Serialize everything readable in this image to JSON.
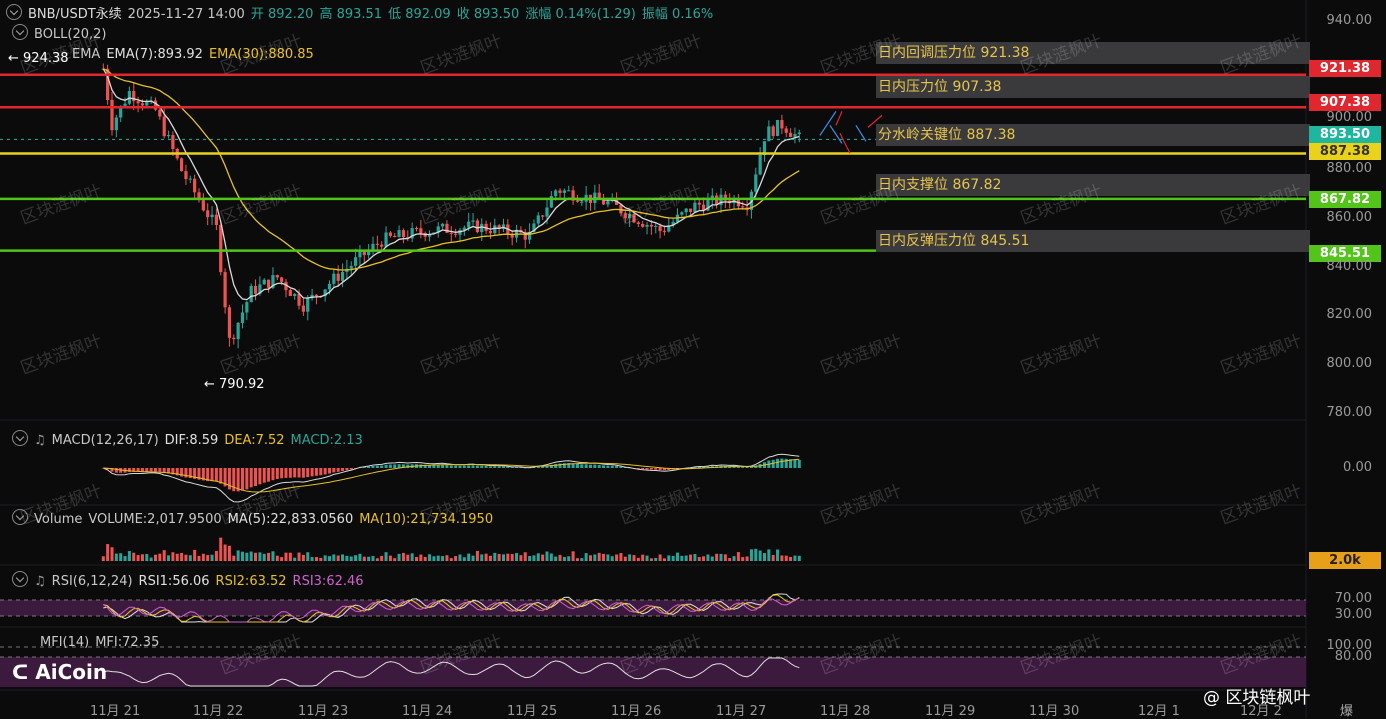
{
  "header": {
    "symbol": "BNB/USDT永续",
    "datetime": "2025-11-27 14:00",
    "open": "开 892.20",
    "high": "高 893.51",
    "low": "低 892.09",
    "close": "收 893.50",
    "change": "涨幅 0.14%(1.29)",
    "amplitude": "振幅 0.16%"
  },
  "indicators": {
    "boll": "BOLL(20,2)",
    "ema": "EMA",
    "ema7": "EMA(7):893.92",
    "ema30": "EMA(30):880.85",
    "macd_name": "MACD(12,26,17)",
    "dif": "DIF:8.59",
    "dea": "DEA:7.52",
    "macd": "MACD:2.13",
    "volume_name": "Volume",
    "volume": "VOLUME:2,017.9500",
    "ma5": "MA(5):22,833.0560",
    "ma10": "MA(10):21,734.1950",
    "rsi_name": "RSI(6,12,24)",
    "rsi1": "RSI1:56.06",
    "rsi2": "RSI2:63.52",
    "rsi3": "RSI3:62.46",
    "mfi_name": "MFI(14)",
    "mfi": "MFI:72.35"
  },
  "annotations": {
    "high_label": "← 924.38",
    "low_label": "← 790.92"
  },
  "levels": [
    {
      "label": "日内回调压力位 921.38",
      "price": "921.38",
      "value": 921.38,
      "color": "#e0262e"
    },
    {
      "label": "日内压力位 907.38",
      "price": "907.38",
      "value": 907.38,
      "color": "#e0262e"
    },
    {
      "label": "分水岭关键位 887.38",
      "price": "887.38",
      "value": 887.38,
      "color": "#e8d21a"
    },
    {
      "label": "日内支撑位 867.82",
      "price": "867.82",
      "value": 867.82,
      "color": "#52c41a"
    },
    {
      "label": "日内反弹压力位 845.51",
      "price": "845.51",
      "value": 845.51,
      "color": "#52c41a"
    }
  ],
  "current_price": {
    "value": 893.5,
    "label": "893.50"
  },
  "volume_tag": "2.0k",
  "price_axis": [
    "940.00",
    "900.00",
    "880.00",
    "860.00",
    "840.00",
    "820.00",
    "800.00",
    "780.00"
  ],
  "macd_axis": [
    "0.00"
  ],
  "rsi_axis": [
    "70.00",
    "30.00"
  ],
  "mfi_axis": [
    "100.00",
    "80.00"
  ],
  "dates": [
    "11月 21",
    "11月 22",
    "11月 23",
    "11月 24",
    "11月 25",
    "11月 26",
    "11月 27",
    "11月 28",
    "11月 29",
    "11月 30",
    "12月 1",
    "12月 2"
  ],
  "corner_glyph": "爆",
  "watermark": "区块涟枫叶",
  "logo": "AiCoin",
  "brand": "@ 区块链枫叶",
  "colors": {
    "up": "#26a69a",
    "down": "#ef5350",
    "ema7": "#d9d9d9",
    "ema30": "#e8c020",
    "rsi_band": "#3c1a3e"
  },
  "chart_data": {
    "type": "candlestick",
    "timeframe": "hourly",
    "ylim": [
      775,
      945
    ],
    "series": [
      {
        "name": "EMA(7)",
        "last": 893.92
      },
      {
        "name": "EMA(30)",
        "last": 880.85
      }
    ],
    "approx_path": [
      {
        "x": "11月 20 22:00",
        "y": 924
      },
      {
        "x": "11月 21 00:00",
        "y": 900
      },
      {
        "x": "11月 21 04:00",
        "y": 914
      },
      {
        "x": "11月 21 10:00",
        "y": 906
      },
      {
        "x": "11月 21 16:00",
        "y": 880
      },
      {
        "x": "11月 22 00:00",
        "y": 855
      },
      {
        "x": "11月 22 03:00",
        "y": 806
      },
      {
        "x": "11月 22 08:00",
        "y": 828
      },
      {
        "x": "11月 22 14:00",
        "y": 834
      },
      {
        "x": "11月 22 20:00",
        "y": 822
      },
      {
        "x": "11月 23 06:00",
        "y": 838
      },
      {
        "x": "11月 23 14:00",
        "y": 850
      },
      {
        "x": "11月 24 00:00",
        "y": 854
      },
      {
        "x": "11月 24 12:00",
        "y": 856
      },
      {
        "x": "11月 25 00:00",
        "y": 852
      },
      {
        "x": "11月 25 06:00",
        "y": 872
      },
      {
        "x": "11月 25 18:00",
        "y": 866
      },
      {
        "x": "11月 26 06:00",
        "y": 854
      },
      {
        "x": "11月 26 14:00",
        "y": 865
      },
      {
        "x": "11月 26 22:00",
        "y": 868
      },
      {
        "x": "11月 27 02:00",
        "y": 866
      },
      {
        "x": "11月 27 06:00",
        "y": 896
      },
      {
        "x": "11月 27 10:00",
        "y": 900
      },
      {
        "x": "11月 27 14:00",
        "y": 893.5
      }
    ],
    "high": 924.38,
    "low": 790.92
  }
}
